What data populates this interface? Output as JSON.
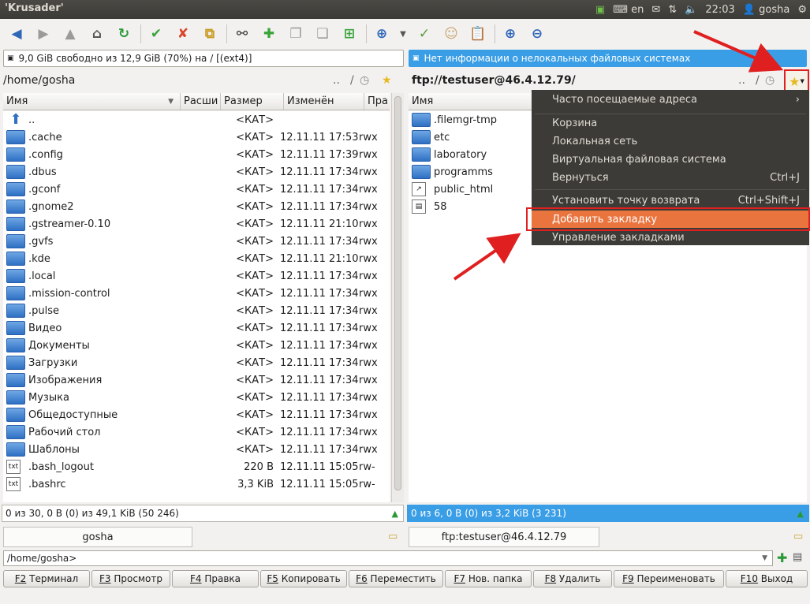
{
  "window": {
    "title": "'Krusader'"
  },
  "tray": {
    "lang": "en",
    "time": "22:03",
    "user": "gosha"
  },
  "left": {
    "free": "9,0 GiB свободно из 12,9 GiB (70%) на / [(ext4)]",
    "path": "/home/gosha",
    "nav_up": "..",
    "nav_root": "/",
    "columns": [
      "Имя",
      "Расши",
      "Размер",
      "Изменён",
      "Пра"
    ],
    "rows": [
      {
        "name": "..",
        "size": "<КАТ>",
        "date": "",
        "perm": "",
        "kind": "up"
      },
      {
        "name": ".cache",
        "size": "<КАТ>",
        "date": "12.11.11 17:53",
        "perm": "rwx",
        "kind": "folder"
      },
      {
        "name": ".config",
        "size": "<КАТ>",
        "date": "12.11.11 17:39",
        "perm": "rwx",
        "kind": "folder"
      },
      {
        "name": ".dbus",
        "size": "<КАТ>",
        "date": "12.11.11 17:34",
        "perm": "rwx",
        "kind": "folder"
      },
      {
        "name": ".gconf",
        "size": "<КАТ>",
        "date": "12.11.11 17:34",
        "perm": "rwx",
        "kind": "folder"
      },
      {
        "name": ".gnome2",
        "size": "<КАТ>",
        "date": "12.11.11 17:34",
        "perm": "rwx",
        "kind": "folder"
      },
      {
        "name": ".gstreamer-0.10",
        "size": "<КАТ>",
        "date": "12.11.11 21:10",
        "perm": "rwx",
        "kind": "folder"
      },
      {
        "name": ".gvfs",
        "size": "<КАТ>",
        "date": "12.11.11 17:34",
        "perm": "rwx",
        "kind": "folder"
      },
      {
        "name": ".kde",
        "size": "<КАТ>",
        "date": "12.11.11 21:10",
        "perm": "rwx",
        "kind": "folder"
      },
      {
        "name": ".local",
        "size": "<КАТ>",
        "date": "12.11.11 17:34",
        "perm": "rwx",
        "kind": "folder"
      },
      {
        "name": ".mission-control",
        "size": "<КАТ>",
        "date": "12.11.11 17:34",
        "perm": "rwx",
        "kind": "folder"
      },
      {
        "name": ".pulse",
        "size": "<КАТ>",
        "date": "12.11.11 17:34",
        "perm": "rwx",
        "kind": "folder"
      },
      {
        "name": "Видео",
        "size": "<КАТ>",
        "date": "12.11.11 17:34",
        "perm": "rwx",
        "kind": "folder"
      },
      {
        "name": "Документы",
        "size": "<КАТ>",
        "date": "12.11.11 17:34",
        "perm": "rwx",
        "kind": "folder"
      },
      {
        "name": "Загрузки",
        "size": "<КАТ>",
        "date": "12.11.11 17:34",
        "perm": "rwx",
        "kind": "folder"
      },
      {
        "name": "Изображения",
        "size": "<КАТ>",
        "date": "12.11.11 17:34",
        "perm": "rwx",
        "kind": "folder"
      },
      {
        "name": "Музыка",
        "size": "<КАТ>",
        "date": "12.11.11 17:34",
        "perm": "rwx",
        "kind": "folder"
      },
      {
        "name": "Общедоступные",
        "size": "<КАТ>",
        "date": "12.11.11 17:34",
        "perm": "rwx",
        "kind": "folder"
      },
      {
        "name": "Рабочий стол",
        "size": "<КАТ>",
        "date": "12.11.11 17:34",
        "perm": "rwx",
        "kind": "folder"
      },
      {
        "name": "Шаблоны",
        "size": "<КАТ>",
        "date": "12.11.11 17:34",
        "perm": "rwx",
        "kind": "folder"
      },
      {
        "name": ".bash_logout",
        "size": "220 B",
        "date": "12.11.11 15:05",
        "perm": "rw-",
        "kind": "file"
      },
      {
        "name": ".bashrc",
        "size": "3,3 KiB",
        "date": "12.11.11 15:05",
        "perm": "rw-",
        "kind": "file"
      }
    ],
    "status": "0 из 30, 0 B (0) из 49,1 KiB (50 246)",
    "tab": "gosha"
  },
  "right": {
    "info": "Нет информации о нелокальных файловых системах",
    "path": "ftp://testuser@46.4.12.79/",
    "nav_up": "..",
    "nav_root": "/",
    "columns": [
      "Имя"
    ],
    "rows": [
      {
        "name": ".filemgr-tmp",
        "kind": "folder"
      },
      {
        "name": "etc",
        "kind": "folder"
      },
      {
        "name": "laboratory",
        "kind": "folder"
      },
      {
        "name": "programms",
        "kind": "folder"
      },
      {
        "name": "public_html",
        "kind": "link"
      },
      {
        "name": "58",
        "kind": "file"
      }
    ],
    "status": "0 из 6, 0 B (0) из 3,2 KiB (3 231)",
    "tab": "ftp:testuser@46.4.12.79"
  },
  "menu": {
    "items": [
      {
        "label": "Часто посещаемые адреса",
        "shortcut": "›"
      },
      {
        "label": "Корзина",
        "shortcut": ""
      },
      {
        "label": "Локальная сеть",
        "shortcut": ""
      },
      {
        "label": "Виртуальная файловая система",
        "shortcut": ""
      },
      {
        "label": "Вернуться",
        "shortcut": "Ctrl+J"
      },
      {
        "label": "Установить точку возврата",
        "shortcut": "Ctrl+Shift+J"
      },
      {
        "label": "Добавить закладку",
        "shortcut": ""
      },
      {
        "label": "Управление закладками",
        "shortcut": ""
      }
    ]
  },
  "cmdline": {
    "value": "/home/gosha>"
  },
  "fkeys": [
    {
      "key": "F2",
      "label": " Терминал"
    },
    {
      "key": "F3",
      "label": " Просмотр"
    },
    {
      "key": "F4",
      "label": " Правка"
    },
    {
      "key": "F5",
      "label": " Копировать"
    },
    {
      "key": "F6",
      "label": " Переместить"
    },
    {
      "key": "F7",
      "label": " Нов. папка"
    },
    {
      "key": "F8",
      "label": " Удалить"
    },
    {
      "key": "F9",
      "label": " Переименовать"
    },
    {
      "key": "F10",
      "label": " Выход"
    }
  ],
  "colors": {
    "accent": "#e9743e",
    "info_bar": "#3a9ee6",
    "topbar": "#3c3b37",
    "annotation": "#e02020"
  }
}
